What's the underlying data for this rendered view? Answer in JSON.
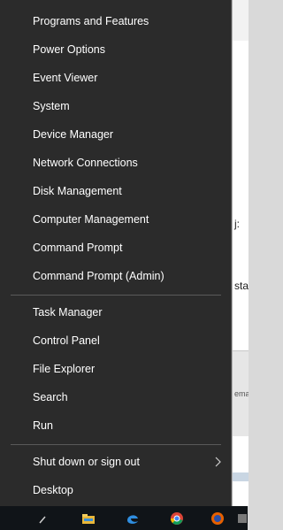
{
  "menu": {
    "group1": [
      "Programs and Features",
      "Power Options",
      "Event Viewer",
      "System",
      "Device Manager",
      "Network Connections",
      "Disk Management",
      "Computer Management",
      "Command Prompt",
      "Command Prompt (Admin)"
    ],
    "group2": [
      "Task Manager",
      "Control Panel",
      "File Explorer",
      "Search",
      "Run"
    ],
    "group3": [
      "Shut down or sign out",
      "Desktop"
    ],
    "submenu_icon": "chevron-right-icon"
  },
  "background_window": {
    "fragment_1": "j:",
    "fragment_2": "sta",
    "fragment_3": "ema"
  },
  "taskbar": {
    "icons": [
      "search-icon",
      "file-explorer-icon",
      "edge-icon",
      "chrome-icon",
      "firefox-icon",
      "app-icon"
    ]
  },
  "colors": {
    "menu_bg": "#2b2b2b",
    "menu_text": "#ffffff",
    "separator": "#5a5a5a",
    "taskbar_bg": "#101418"
  }
}
